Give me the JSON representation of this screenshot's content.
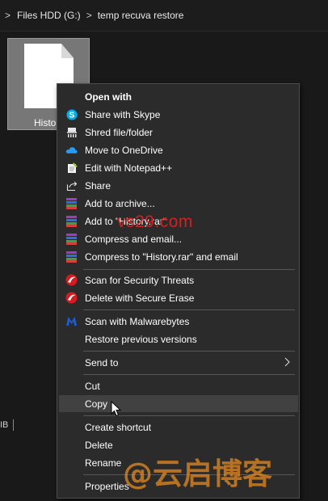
{
  "breadcrumb": {
    "drive": "Files HDD (G:)",
    "folder": "temp recuva restore",
    "separator": ">"
  },
  "file": {
    "name": "Histo"
  },
  "statusbar": {
    "size_fragment": "IB"
  },
  "context_menu": {
    "open_with": "Open with",
    "share_skype": "Share with Skype",
    "shred": "Shred file/folder",
    "onedrive": "Move to OneDrive",
    "notepadpp": "Edit with Notepad++",
    "share": "Share",
    "add_archive": "Add to archive...",
    "add_rar": "Add to \"History.rar\"",
    "compress_email": "Compress and email...",
    "compress_rar_email": "Compress to \"History.rar\" and email",
    "scan_threats": "Scan for Security Threats",
    "secure_erase": "Delete with Secure Erase",
    "malwarebytes": "Scan with Malwarebytes",
    "restore_versions": "Restore previous versions",
    "send_to": "Send to",
    "cut": "Cut",
    "copy": "Copy",
    "create_shortcut": "Create shortcut",
    "delete": "Delete",
    "rename": "Rename",
    "properties": "Properties",
    "hovered_item": "Copy"
  },
  "watermarks": {
    "site": "vs29.com",
    "blog": "@云启博客"
  },
  "colors": {
    "menu_bg": "#2b2b2b",
    "hover_bg": "#414141",
    "skype": "#00aff0",
    "onedrive": "#2b9af3",
    "trend_red": "#d71920",
    "malwarebytes": "#1c5dd8"
  }
}
